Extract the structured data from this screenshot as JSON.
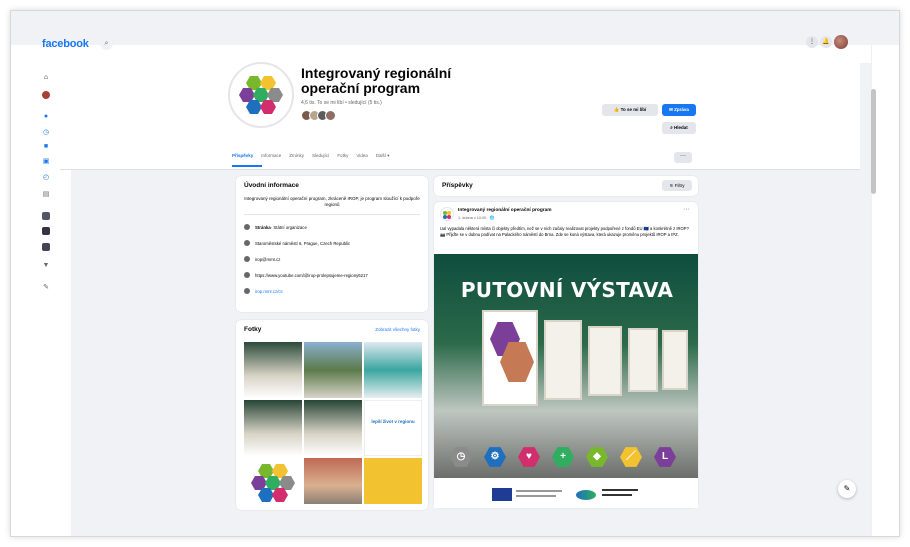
{
  "brand": {
    "logo_text": "facebook",
    "accent": "#1877f2"
  },
  "page": {
    "title": "Integrovaný regionální operační program",
    "subtitle": "4,6 tis. To se mi líbí • sledující (5 tis.)"
  },
  "actions": {
    "like_label": "To se mi líbí",
    "message_label": "Zpráva",
    "search_label": "Hledat"
  },
  "tabs": [
    {
      "label": "Příspěvky"
    },
    {
      "label": "Informace"
    },
    {
      "label": "Zmínky"
    },
    {
      "label": "Sledující"
    },
    {
      "label": "Fotky"
    },
    {
      "label": "Videa"
    },
    {
      "label": "Další ▾"
    }
  ],
  "intro": {
    "title": "Úvodní informace",
    "description": "Integrovaný regionální operační program, zkráceně IROP, je program sloužící k podpoře regionů",
    "rows": [
      {
        "label_bold": "Stránka",
        "label": " · Státní organizace",
        "icon": "info-icon"
      },
      {
        "label": "Staroměstské náměstí 6, Prague, Czech Republic",
        "icon": "location-icon"
      },
      {
        "label": "irop@mmr.cz",
        "icon": "mail-icon"
      },
      {
        "label": "https://www.youtube.com/@irop-prolepsujeme-regiony6217",
        "icon": "youtube-icon"
      },
      {
        "label": "irop.mmr.cz/cs",
        "icon": "web-icon",
        "is_link": true
      }
    ]
  },
  "photos": {
    "title": "Fotky",
    "see_all": "Zobrazit všechny fotky"
  },
  "posts": {
    "title": "Příspěvky",
    "filter_label": "Filtry",
    "post": {
      "author": "Integrovaný regionální operační program",
      "meta": "1. dubna v 10:00 · 🌐",
      "text": "Ual vypadala některá místa či objekty předtím, než se v nich začaly realizovat projekty podpořené z fondů EU 🇪🇺 a konkrétně z IROP? 📷 Přijďte se v dubnu podívat na Palackého náměstí do Brna. Zde se koná výstava, která ukazuje proměnu projektů IROP a IPZ.",
      "banner_title": "PUTOVNÍ VÝSTAVA"
    }
  },
  "colors": {
    "hex": [
      "#8b8b8b",
      "#1f6fbf",
      "#d22e6e",
      "#2eae5e",
      "#79b82d",
      "#f2c230",
      "#7b3f9a"
    ]
  }
}
